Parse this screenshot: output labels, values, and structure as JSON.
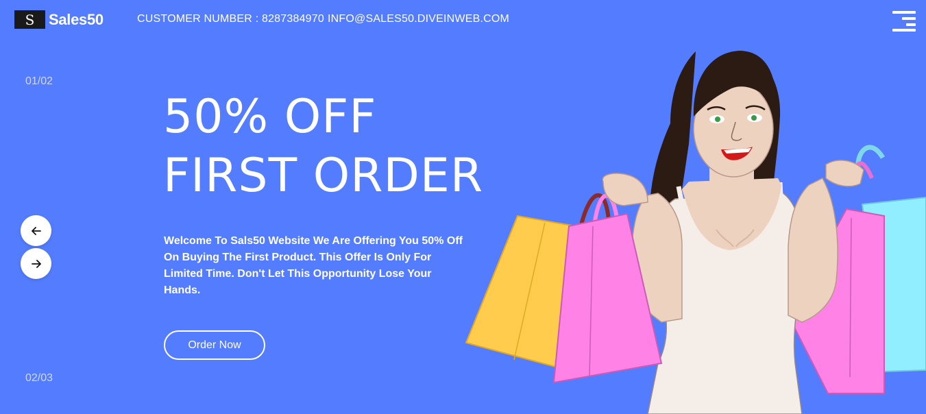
{
  "brand": {
    "logo_letter": "S",
    "name": "Sales50"
  },
  "header": {
    "customer_number": "CUSTOMER NUMBER : 8287384970",
    "email": "INFO@SALES50.DIVEINWEB.COM"
  },
  "slider": {
    "current": "01/02",
    "next": "02/03",
    "prev_icon": "arrow-left-icon",
    "next_icon": "arrow-right-icon"
  },
  "hero": {
    "headline_line1": "50% OFF",
    "headline_line2": "FIRST ORDER",
    "description": "Welcome To Sals50 Website We Are Offering You 50% Off On Buying The First Product. This Offer Is Only For Limited Time. Don't Let This Opportunity Lose Your Hands.",
    "cta_label": "Order Now"
  },
  "colors": {
    "background": "#537cfe",
    "text": "#ffffff",
    "bag_yellow": "#ffcc4d",
    "bag_pink": "#ff82e6",
    "bag_cyan": "#90eefe"
  }
}
